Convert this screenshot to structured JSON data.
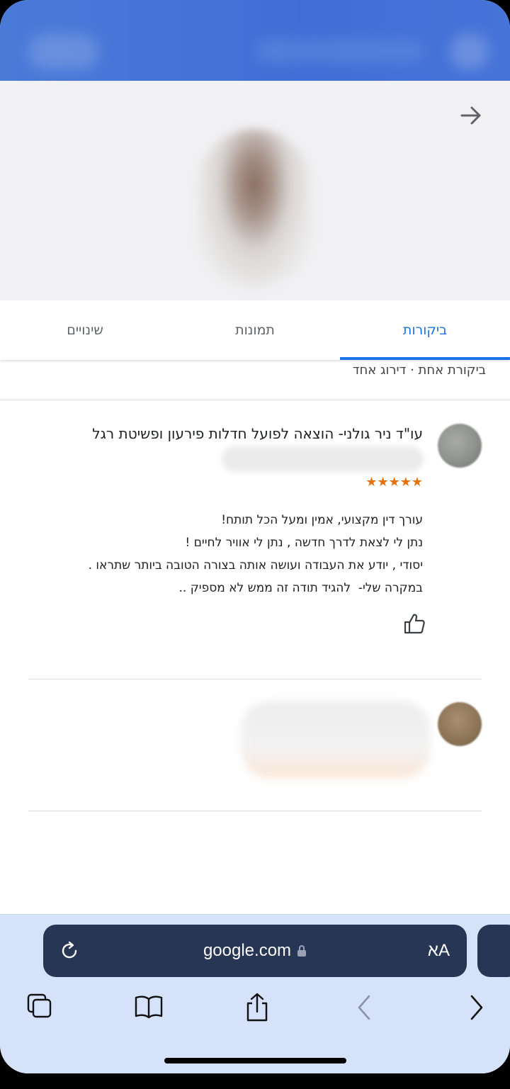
{
  "tabs": [
    {
      "label": "ביקורות",
      "active": true
    },
    {
      "label": "תמונות",
      "active": false
    },
    {
      "label": "שינויים",
      "active": false
    }
  ],
  "summary": "ביקורת אחת · דירוג אחד",
  "review": {
    "title": "עו\"ד ניר גולני- הוצאה לפועל חדלות פירעון ופשיטת רגל",
    "stars": "★★★★★",
    "rating": 5,
    "body_lines": [
      "עורך דין מקצועי, אמין ומעל הכל תותח!",
      "נתן לי לצאת לדרך חדשה , נתן לי אוויר לחיים !",
      "יסודי , יודע את העבודה ועושה אותה בצורה הטובה ביותר שתראו .",
      "במקרה שלי-  להגיד תודה זה ממש לא מספיק .."
    ]
  },
  "browser": {
    "url": "google.com",
    "aa_label": "אA"
  },
  "colors": {
    "accent": "#1a73e8",
    "star": "#e8710a",
    "url_bar": "#283655",
    "toolbar_bg": "#d6e2fa"
  }
}
